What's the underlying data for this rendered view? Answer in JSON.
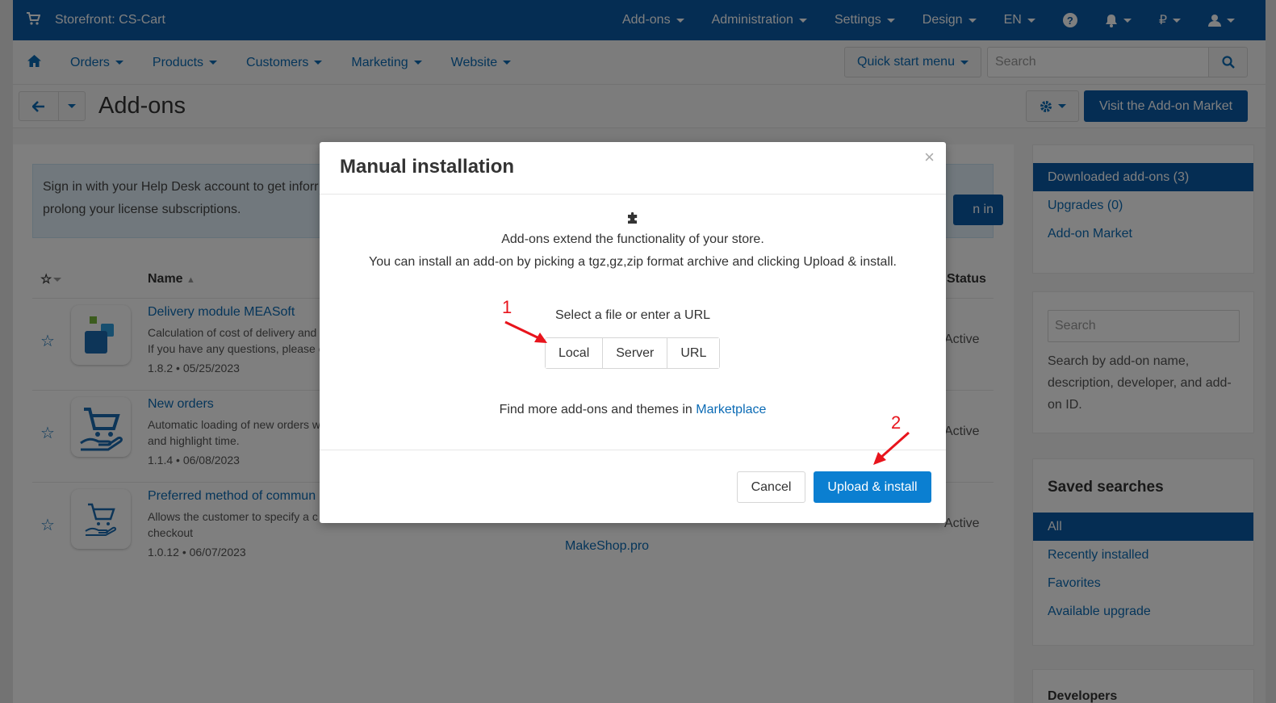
{
  "topbar": {
    "store_label": "Storefront: CS-Cart",
    "menus": [
      "Add-ons",
      "Administration",
      "Settings",
      "Design",
      "EN"
    ],
    "currency": "₽"
  },
  "nav": {
    "items": [
      "Orders",
      "Products",
      "Customers",
      "Marketing",
      "Website"
    ],
    "quick_start": "Quick start menu",
    "search_placeholder": "Search"
  },
  "page": {
    "title": "Add-ons",
    "market_button": "Visit the Add-on Market"
  },
  "notice": {
    "text": "Sign in with your Help Desk account to get information about your licenses, and to be able to prolong your license subscriptions.",
    "line1": "Sign in with your Help Desk account to get inforr",
    "line2": "prolong your license subscriptions.",
    "button_visible": "n in"
  },
  "table": {
    "col_name": "Name",
    "col_status": "Status",
    "rows": [
      {
        "title": "Delivery module MEASoft",
        "desc1": "Calculation of cost of delivery and s",
        "desc2": "If you have any questions, please co",
        "meta": "1.8.2 • 05/25/2023",
        "status": "Active"
      },
      {
        "title": "New orders",
        "desc1": "Automatic loading of new orders w",
        "desc2": "and highlight time.",
        "meta": "1.1.4 • 06/08/2023",
        "status": "Active"
      },
      {
        "title": "Preferred method of commun",
        "desc1": "Allows the customer to specify a c",
        "desc2": "checkout",
        "meta": "1.0.12 • 06/07/2023",
        "status": "Active",
        "developer": "MakeShop.pro"
      }
    ]
  },
  "sidebar": {
    "filters": [
      {
        "label": "Downloaded add-ons (3)",
        "active": true
      },
      {
        "label": "Upgrades (0)",
        "active": false
      },
      {
        "label": "Add-on Market",
        "active": false
      }
    ],
    "search_placeholder": "Search",
    "search_hint": "Search by add-on name, description, developer, and add-on ID.",
    "saved_heading": "Saved searches",
    "saved": [
      {
        "label": "All",
        "active": true
      },
      {
        "label": "Recently installed",
        "active": false
      },
      {
        "label": "Favorites",
        "active": false
      },
      {
        "label": "Available upgrade",
        "active": false
      }
    ],
    "developers_heading": "Developers"
  },
  "modal": {
    "title": "Manual installation",
    "close": "×",
    "intro1": "Add-ons extend the functionality of your store.",
    "intro2": "You can install an add-on by picking a tgz,gz,zip format archive and clicking Upload & install.",
    "select_label": "Select a file or enter a URL",
    "sources": [
      "Local",
      "Server",
      "URL"
    ],
    "find_more": "Find more add-ons and themes in",
    "marketplace_link": "Marketplace",
    "cancel": "Cancel",
    "upload": "Upload & install"
  },
  "annotations": {
    "step1": "1",
    "step2": "2"
  },
  "colors": {
    "brand": "#0b5aa6",
    "link": "#0b6bb5",
    "primary_button": "#0b7fd1",
    "annotation": "#e8141c"
  }
}
